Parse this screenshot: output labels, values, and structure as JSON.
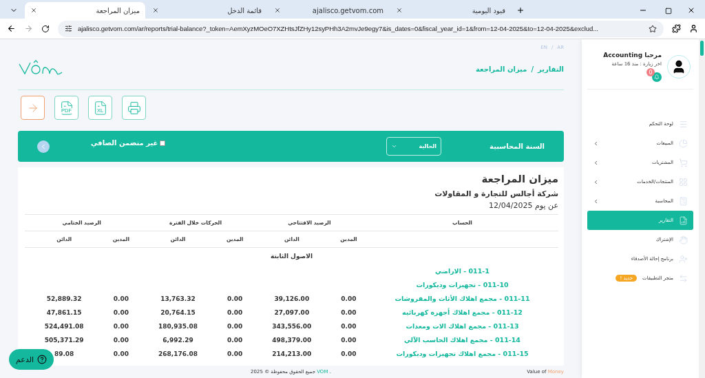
{
  "browser": {
    "active_tab": {
      "title": "ميزان المراجعة",
      "selected": true
    },
    "second_tab": {
      "title": "قائمة الدخل",
      "selected": false
    },
    "third_tab": {
      "title": "ajalisco.getvom.com",
      "selected": false
    },
    "fourth_tab": {
      "title": "قيود اليومية",
      "selected": false
    },
    "address": "ajalisco.getvom.com/ar/reports/trial-balance?_token=AemXyzMOeO7XZHtsJfZHy12syPHh3A2mvJe9egy7&is_dates=0&fiscal_year_id=1&from=12-04-2025&to=12-04-2025&exclud..."
  },
  "lang": {
    "en": "EN",
    "sep": "/",
    "ar": "AR"
  },
  "breadcrumb": {
    "parent": "التقارير",
    "sep": "/",
    "current": "ميزان المراجعة"
  },
  "export_buttons": [
    {
      "kind": "print"
    },
    {
      "kind": "xl",
      "label": "XL"
    },
    {
      "kind": "pdf",
      "label": "PDF"
    },
    {
      "kind": "back"
    }
  ],
  "filters": {
    "fiscal_year_label": "السنة المحاسبية",
    "fiscal_year_value": "الحالية",
    "exclude_zero": {
      "label": "غير متضمن الصافي",
      "checked": false
    }
  },
  "report": {
    "title": "ميزان المراجعة",
    "company": "شركة أجالس للتجارة و المقاولات",
    "date": "عن يوم 12/04/2025",
    "groups": [
      "الحساب",
      "الرصيد الافتتاحي",
      "الحركات خلال الفترة",
      "الرصيد الختامي"
    ],
    "subheaders": [
      "المدين",
      "الدائن",
      "المدين",
      "الدائن",
      "المدين",
      "الدائن"
    ],
    "section": "الاصول الثابتة",
    "rows": [
      {
        "account": "011-1 - الاراضي",
        "values": []
      },
      {
        "account": "011-10 - تجهيزات وديكورات",
        "values": []
      },
      {
        "account": "011-11 - مجمع اهلاك الأثاث والمفروشات",
        "values": [
          "0.00",
          "39,126.00",
          "0.00",
          "13,763.32",
          "0.00",
          "52,889.32"
        ]
      },
      {
        "account": "011-12 - مجمع اهلاك أجهزه كهربائيه",
        "values": [
          "0.00",
          "27,097.00",
          "0.00",
          "20,764.15",
          "0.00",
          "47,861.15"
        ]
      },
      {
        "account": "011-13 - مجمع اهلاك الات ومعدات",
        "values": [
          "0.00",
          "343,556.00",
          "0.00",
          "180,935.08",
          "0.00",
          "524,491.08"
        ]
      },
      {
        "account": "011-14 - مجمع اهلاك الحاسب الآلي",
        "values": [
          "0.00",
          "498,379.00",
          "0.00",
          "6,992.29",
          "0.00",
          "505,371.29"
        ]
      },
      {
        "account": "011-15 - مجمع اهلاك تجهيزات وديكورات",
        "values": [
          "0.00",
          "214,213.00",
          "0.00",
          "268,176.08",
          "0.00",
          "89.08"
        ]
      }
    ]
  },
  "support": {
    "label": "الدعم"
  },
  "footer": {
    "rights": "جميع الحقوق محفوظة © 2025",
    "brand": "VOM",
    "dot": ".",
    "tagline": "Value of",
    "tagline_brand": "Money"
  },
  "sidebar": {
    "greeting": "مرحبا Accounting",
    "last_visit": "اخر زيارة : منذ 16 ساعة",
    "notifications": "0",
    "items": [
      {
        "label": "لوحة التحكم",
        "has_children": false,
        "selected": false
      },
      {
        "label": "المبيعات",
        "has_children": true,
        "selected": false
      },
      {
        "label": "المشتريات",
        "has_children": true,
        "selected": false
      },
      {
        "label": "المنتجات/الخدمات",
        "has_children": true,
        "selected": false
      },
      {
        "label": "المحاسبة",
        "has_children": true,
        "selected": false
      },
      {
        "label": "التقارير",
        "has_children": false,
        "selected": true
      },
      {
        "label": "الإشتراك",
        "has_children": false,
        "selected": false
      },
      {
        "label": "برنامج إحالة الأصدقاء",
        "has_children": false,
        "selected": false
      },
      {
        "label": "متجر التطبيقات",
        "has_children": false,
        "selected": false,
        "badge": "جديد !"
      }
    ]
  }
}
